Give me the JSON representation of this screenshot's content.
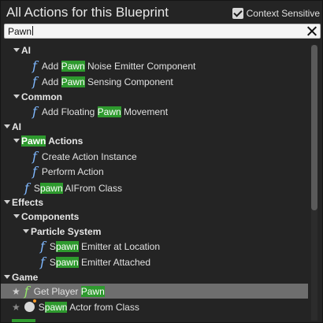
{
  "window": {
    "title": "All Actions for this Blueprint"
  },
  "context_sensitive": {
    "label": "Context Sensitive",
    "checked": true
  },
  "search": {
    "value": "Pawn"
  },
  "tree": [
    {
      "kind": "category",
      "label": "AI"
    },
    {
      "kind": "action",
      "pre": "Add ",
      "hl": "Pawn",
      "post": " Noise Emitter Component"
    },
    {
      "kind": "action",
      "pre": "Add ",
      "hl": "Pawn",
      "post": " Sensing Component"
    },
    {
      "kind": "category",
      "label": "Common"
    },
    {
      "kind": "action",
      "pre": "Add Floating ",
      "hl": "Pawn",
      "post": " Movement"
    },
    {
      "kind": "category",
      "label": "AI"
    },
    {
      "kind": "category",
      "pre": "",
      "hl": "Pawn",
      "post": " Actions"
    },
    {
      "kind": "action",
      "pre": "Create Action Instance",
      "hl": "",
      "post": ""
    },
    {
      "kind": "action",
      "pre": "Perform Action",
      "hl": "",
      "post": ""
    },
    {
      "kind": "action",
      "pre": "S",
      "hl": "pawn",
      "post": " AIFrom Class"
    },
    {
      "kind": "category",
      "label": "Effects"
    },
    {
      "kind": "category",
      "label": "Components"
    },
    {
      "kind": "category",
      "label": "Particle System"
    },
    {
      "kind": "action",
      "pre": "S",
      "hl": "pawn",
      "post": " Emitter at Location"
    },
    {
      "kind": "action",
      "pre": "S",
      "hl": "pawn",
      "post": " Emitter Attached"
    },
    {
      "kind": "category",
      "label": "Game"
    },
    {
      "kind": "action",
      "pre": "Get Player ",
      "hl": "Pawn",
      "post": ""
    },
    {
      "kind": "action",
      "pre": "S",
      "hl": "pawn",
      "post": " Actor from Class"
    }
  ],
  "colors": {
    "highlight": "#2e9a2e",
    "function_icon": "#7fb8ff",
    "selected_row": "#6e6e6e"
  },
  "icons": {
    "function": "f",
    "favorite": "★",
    "actor": "bomb-icon"
  }
}
